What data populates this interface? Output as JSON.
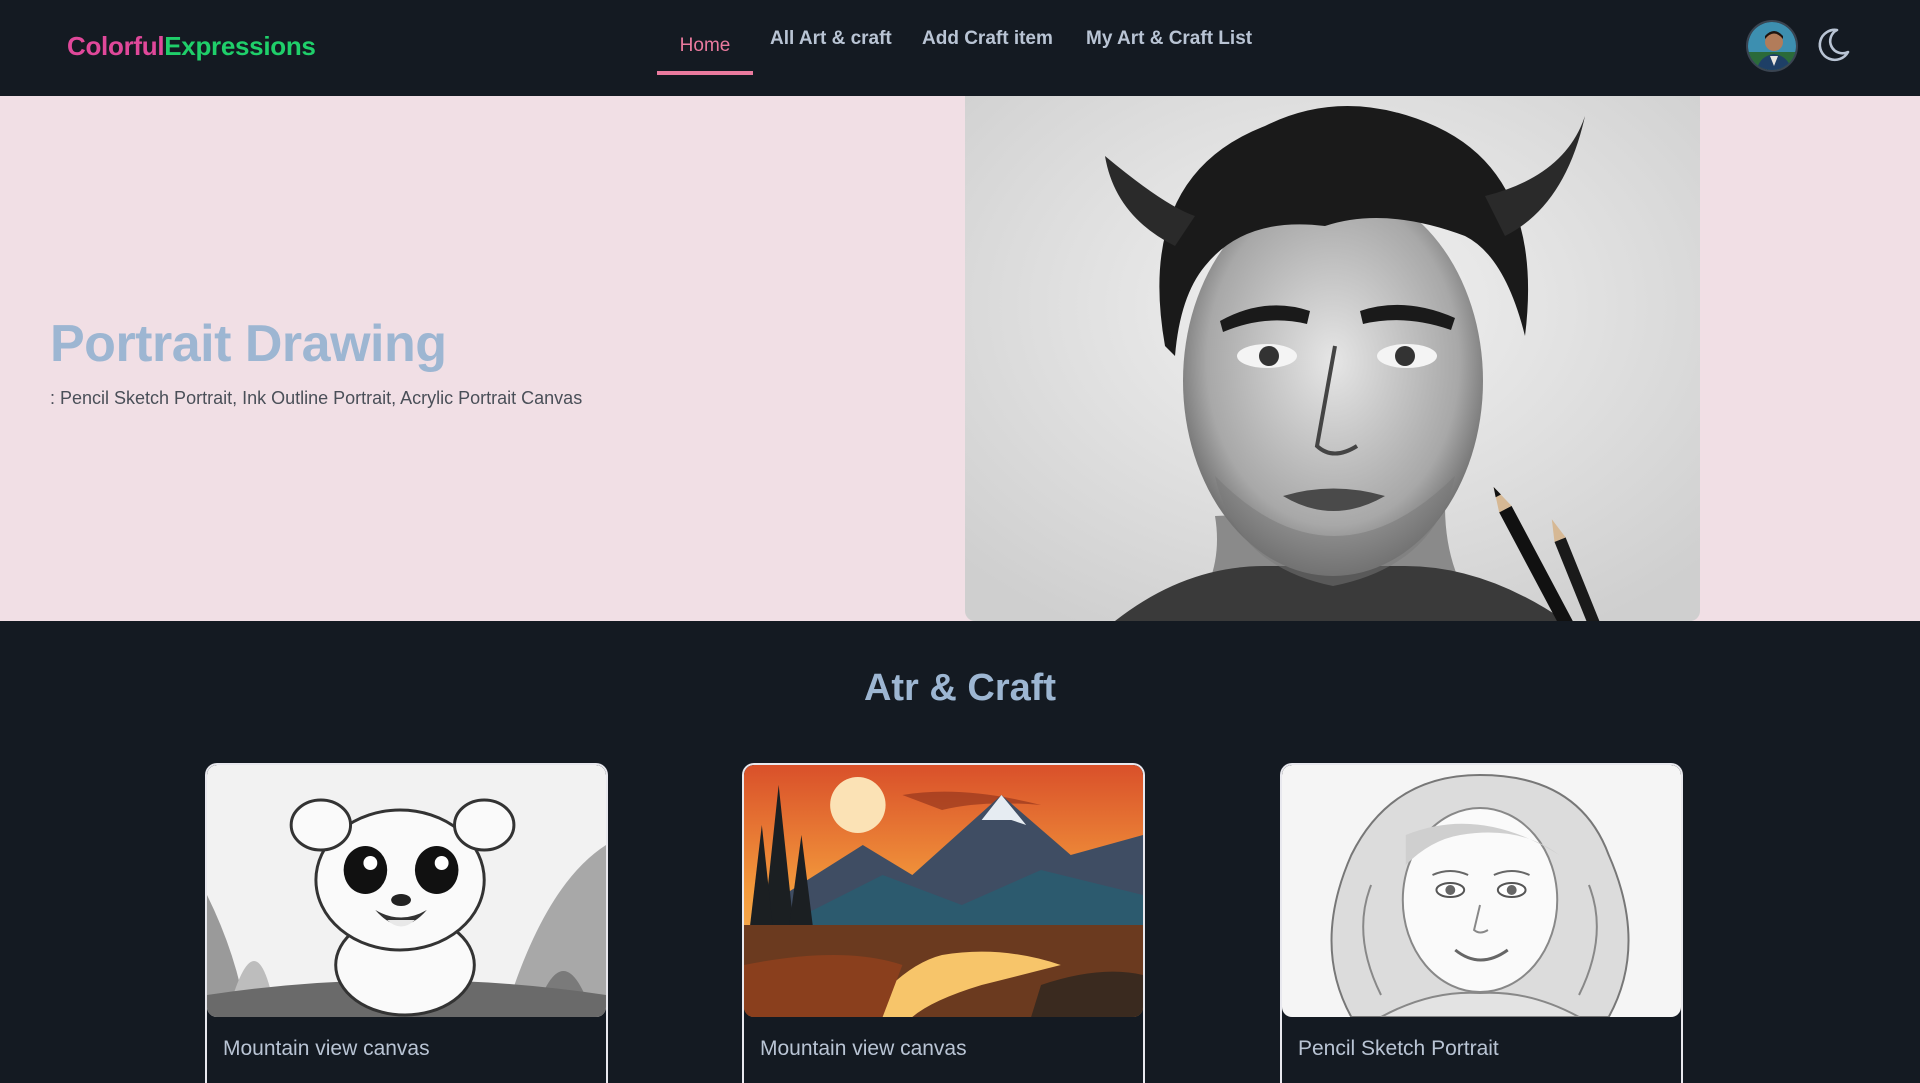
{
  "brand": {
    "part1": "Colorful",
    "part2": "Expressions"
  },
  "nav": {
    "home": "Home",
    "all": "All Art & craft",
    "add": "Add Craft item",
    "mylist": "My Art & Craft List"
  },
  "hero": {
    "title": "Portrait Drawing",
    "subtitle": ": Pencil Sketch Portrait, Ink Outline Portrait, Acrylic Portrait Canvas"
  },
  "section": {
    "title": "Atr & Craft"
  },
  "cards": [
    {
      "title": "Mountain view canvas",
      "image": "cartoon-lion-cub-sketch"
    },
    {
      "title": "Mountain view canvas",
      "image": "sunset-mountain-landscape"
    },
    {
      "title": "Pencil Sketch Portrait",
      "image": "pencil-portrait-girl"
    }
  ],
  "colors": {
    "background": "#141a22",
    "hero_bg": "#f1dfe5",
    "accent_pink": "#ea7a9e",
    "brand_pink": "#e0489a",
    "brand_green": "#1fcf6a",
    "heading_blue": "#9db6d2"
  }
}
